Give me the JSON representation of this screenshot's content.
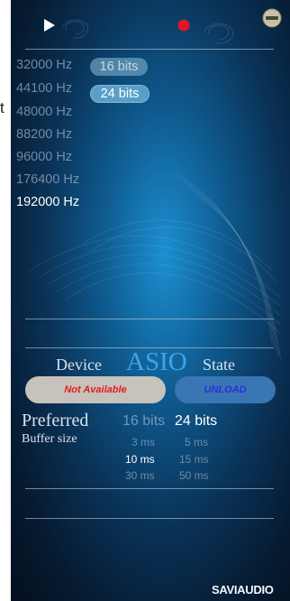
{
  "stray_char": "t",
  "toolbar": {
    "play_icon": "play-icon",
    "record_icon": "record-icon",
    "minimize_icon": "minimize-icon"
  },
  "sample_rates": [
    {
      "label": "32000 Hz",
      "selected": false
    },
    {
      "label": "44100 Hz",
      "selected": false
    },
    {
      "label": "48000 Hz",
      "selected": false
    },
    {
      "label": "88200 Hz",
      "selected": false
    },
    {
      "label": "96000 Hz",
      "selected": false
    },
    {
      "label": "176400 Hz",
      "selected": false
    },
    {
      "label": "192000 Hz",
      "selected": true
    }
  ],
  "bit_depth_pills": [
    {
      "label": "16 bits",
      "selected": false
    },
    {
      "label": "24 bits",
      "selected": true
    }
  ],
  "driver": {
    "device_label": "Device",
    "asio_label": "ASIO",
    "state_label": "State",
    "device_value": "Not Available",
    "state_button": "UNLOAD"
  },
  "preferred": {
    "title": "Preferred",
    "bits_16": "16 bits",
    "bits_24": "24 bits",
    "bits_selected": "24 bits"
  },
  "buffer": {
    "title": "Buffer size",
    "options": [
      {
        "label": "3 ms",
        "selected": false
      },
      {
        "label": "5 ms",
        "selected": false
      },
      {
        "label": "10 ms",
        "selected": true
      },
      {
        "label": "15 ms",
        "selected": false
      },
      {
        "label": "30 ms",
        "selected": false
      },
      {
        "label": "50 ms",
        "selected": false
      }
    ]
  },
  "brand": {
    "logo": "SAVIAUDIO"
  },
  "colors": {
    "record": "#e0162b",
    "asio": "#3fa3ea",
    "not_available": "#e11d1d",
    "unload_bg": "#3a75b4"
  }
}
